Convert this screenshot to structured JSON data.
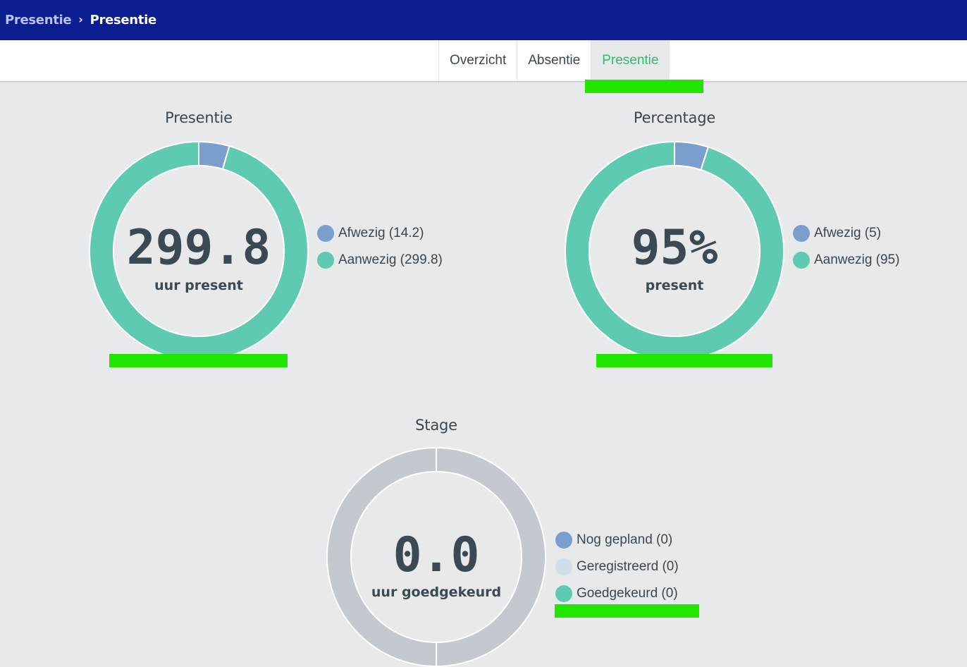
{
  "breadcrumb": {
    "parent": "Presentie",
    "separator": "›",
    "current": "Presentie"
  },
  "tabs": [
    {
      "label": "Overzicht",
      "active": false
    },
    {
      "label": "Absentie",
      "active": false
    },
    {
      "label": "Presentie",
      "active": true
    }
  ],
  "colors": {
    "header": "#0b1d8f",
    "active_tab": "#2bbf6a",
    "afwezig": "#7b9fcc",
    "aanwezig": "#5ecbb0",
    "geregistreerd": "#d3dde9",
    "empty": "#c4c9cf"
  },
  "charts": {
    "presentie": {
      "title": "Presentie",
      "center_value": "299.8",
      "center_label": "uur present",
      "legend": [
        {
          "label": "Afwezig (14.2)",
          "color": "#7b9fcc"
        },
        {
          "label": "Aanwezig (299.8)",
          "color": "#5ecbb0"
        }
      ]
    },
    "percentage": {
      "title": "Percentage",
      "center_value": "95%",
      "center_label": "present",
      "legend": [
        {
          "label": "Afwezig (5)",
          "color": "#7b9fcc"
        },
        {
          "label": "Aanwezig (95)",
          "color": "#5ecbb0"
        }
      ]
    },
    "stage": {
      "title": "Stage",
      "center_value": "0.0",
      "center_label": "uur goedgekeurd",
      "legend": [
        {
          "label": "Nog gepland (0)",
          "color": "#7b9fcc"
        },
        {
          "label": "Geregistreerd (0)",
          "color": "#d3dde9"
        },
        {
          "label": "Goedgekeurd (0)",
          "color": "#5ecbb0"
        }
      ]
    }
  },
  "chart_data": [
    {
      "type": "pie",
      "title": "Presentie",
      "categories": [
        "Afwezig",
        "Aanwezig"
      ],
      "values": [
        14.2,
        299.8
      ],
      "colors": [
        "#7b9fcc",
        "#5ecbb0"
      ]
    },
    {
      "type": "pie",
      "title": "Percentage",
      "categories": [
        "Afwezig",
        "Aanwezig"
      ],
      "values": [
        5,
        95
      ],
      "colors": [
        "#7b9fcc",
        "#5ecbb0"
      ]
    },
    {
      "type": "pie",
      "title": "Stage",
      "categories": [
        "Nog gepland",
        "Geregistreerd",
        "Goedgekeurd"
      ],
      "values": [
        0,
        0,
        0
      ],
      "colors": [
        "#7b9fcc",
        "#d3dde9",
        "#5ecbb0"
      ]
    }
  ]
}
